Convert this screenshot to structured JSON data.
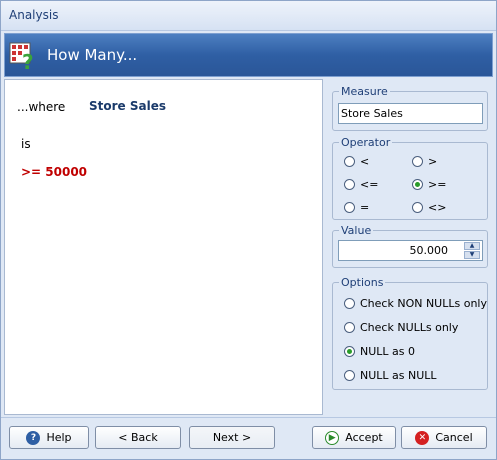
{
  "window": {
    "title": "Analysis"
  },
  "banner": {
    "title": "How Many..."
  },
  "left": {
    "where_label": "...where",
    "measure_name": "Store Sales",
    "is_label": "is",
    "expression": ">= 50000"
  },
  "measure": {
    "label": "Measure",
    "value": "Store Sales"
  },
  "operator": {
    "label": "Operator",
    "options": [
      "<",
      ">",
      "<=",
      ">=",
      "=",
      "<>"
    ],
    "selected": ">="
  },
  "value": {
    "label": "Value",
    "value": "50.000"
  },
  "options_group": {
    "label": "Options",
    "options": [
      "Check NON NULLs only",
      "Check NULLs only",
      "NULL as 0",
      "NULL as NULL"
    ],
    "selected": "NULL as 0"
  },
  "footer": {
    "help": "Help",
    "back": "< Back",
    "next": "Next >",
    "accept": "Accept",
    "cancel": "Cancel"
  },
  "colors": {
    "expression": "#c00000",
    "accent": "#2f5fa4",
    "selected_radio": "#2a9c2a"
  }
}
